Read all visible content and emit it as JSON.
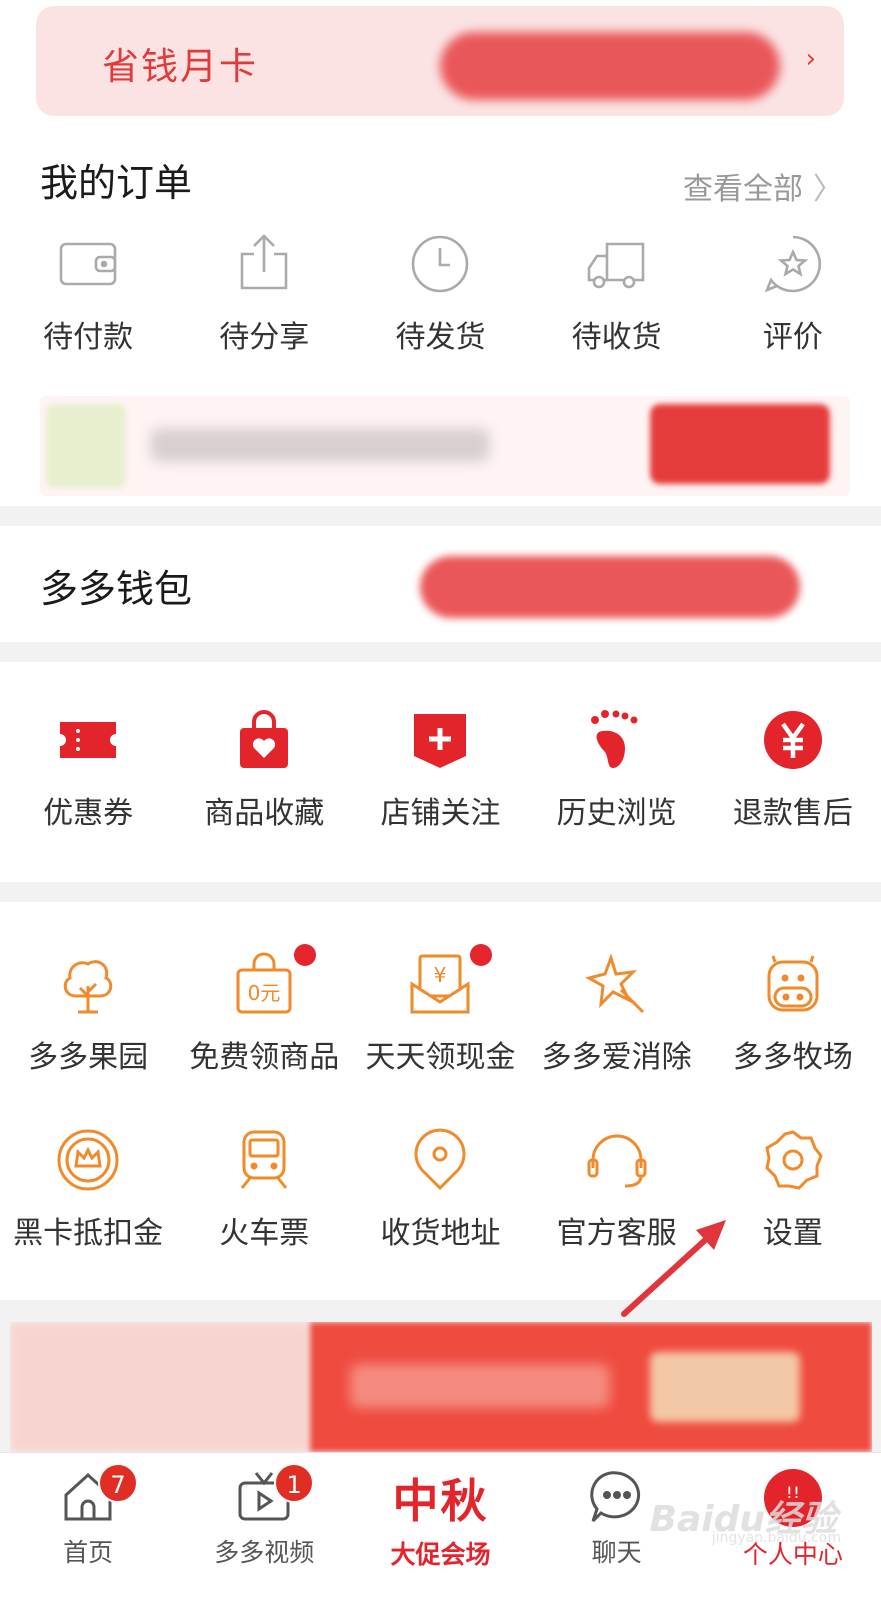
{
  "member_card": {
    "title": "省钱月卡",
    "arrow": "›"
  },
  "orders": {
    "title": "我的订单",
    "view_all": "查看全部",
    "items": [
      {
        "label": "待付款",
        "icon": "wallet-icon"
      },
      {
        "label": "待分享",
        "icon": "share-icon"
      },
      {
        "label": "待发货",
        "icon": "clock-icon"
      },
      {
        "label": "待收货",
        "icon": "truck-icon"
      },
      {
        "label": "评价",
        "icon": "star-bubble-icon"
      }
    ]
  },
  "wallet": {
    "title": "多多钱包"
  },
  "shortcuts": [
    {
      "label": "优惠券",
      "icon": "coupon-icon"
    },
    {
      "label": "商品收藏",
      "icon": "heart-bag-icon"
    },
    {
      "label": "店铺关注",
      "icon": "shop-plus-icon"
    },
    {
      "label": "历史浏览",
      "icon": "footprint-icon"
    },
    {
      "label": "退款售后",
      "icon": "yen-circle-icon"
    }
  ],
  "tools_row1": [
    {
      "label": "多多果园",
      "icon": "tree-icon",
      "dot": false
    },
    {
      "label": "免费领商品",
      "icon": "free-bag-icon",
      "dot": true,
      "bag_text": "0元"
    },
    {
      "label": "天天领现金",
      "icon": "cash-envelope-icon",
      "dot": true,
      "env_text": "¥"
    },
    {
      "label": "多多爱消除",
      "icon": "star-wand-icon",
      "dot": false
    },
    {
      "label": "多多牧场",
      "icon": "cow-icon",
      "dot": false
    }
  ],
  "tools_row2": [
    {
      "label": "黑卡抵扣金",
      "icon": "crown-coin-icon"
    },
    {
      "label": "火车票",
      "icon": "train-icon"
    },
    {
      "label": "收货地址",
      "icon": "location-pin-icon"
    },
    {
      "label": "官方客服",
      "icon": "headset-icon"
    },
    {
      "label": "设置",
      "icon": "gear-icon"
    }
  ],
  "tabbar": [
    {
      "label": "首页",
      "icon": "home-icon",
      "badge": "7"
    },
    {
      "label": "多多视频",
      "icon": "tv-play-icon",
      "badge": "1"
    },
    {
      "big": "中秋",
      "label": "大促会场",
      "icon": "promo-text"
    },
    {
      "label": "聊天",
      "icon": "chat-bubble-icon"
    },
    {
      "label": "个人中心",
      "icon": "avatar-icon",
      "avatar_text": "ꜝꜝ"
    }
  ],
  "watermark": {
    "main": "Baidu经验",
    "sub": "jingyan.baidu.com"
  },
  "colors": {
    "brand_red": "#e3242b",
    "tool_orange": "#f08a2a",
    "gray_icon": "#aaaaaa"
  }
}
